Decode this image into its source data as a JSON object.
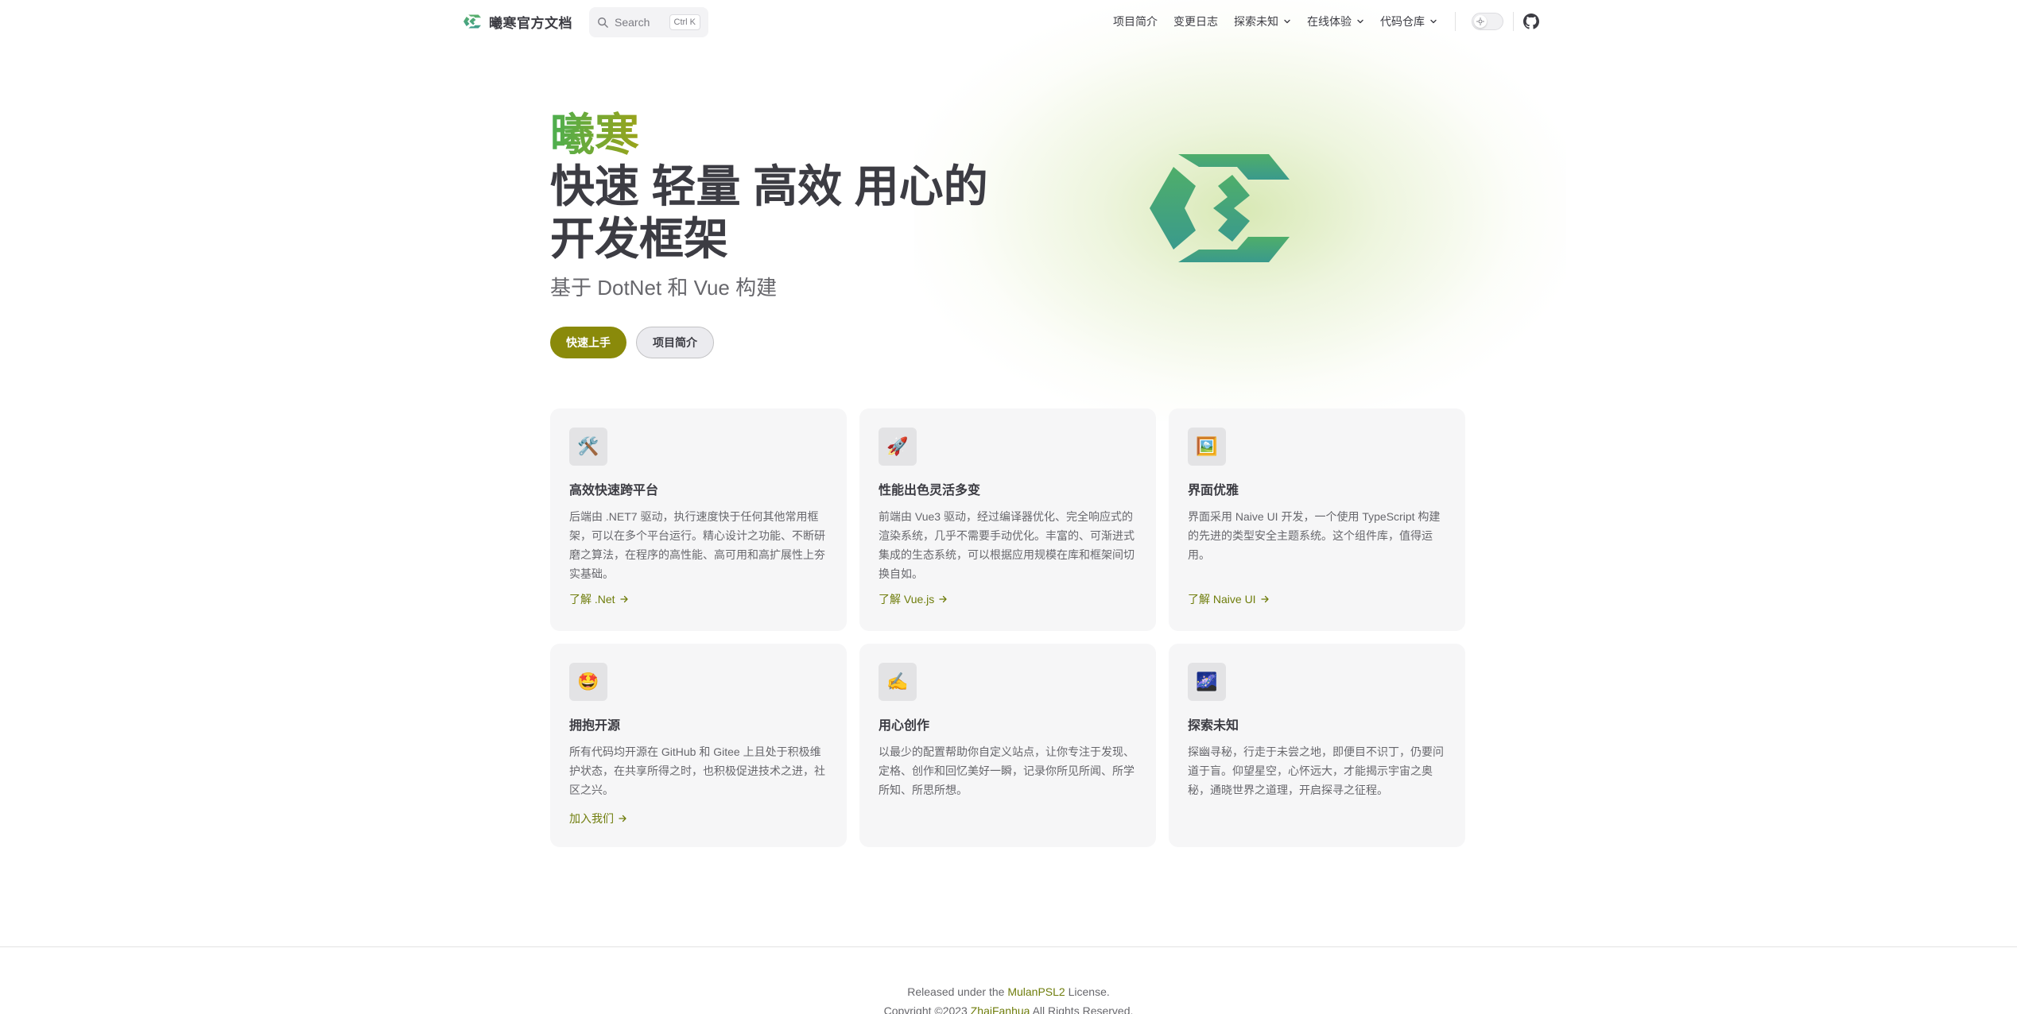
{
  "nav": {
    "title": "曦寒官方文档",
    "search": {
      "label": "Search",
      "shortcut": "Ctrl K"
    },
    "menu": [
      {
        "label": "项目简介",
        "dropdown": false
      },
      {
        "label": "变更日志",
        "dropdown": false
      },
      {
        "label": "探索未知",
        "dropdown": true
      },
      {
        "label": "在线体验",
        "dropdown": true
      },
      {
        "label": "代码仓库",
        "dropdown": true
      }
    ],
    "icons": {
      "logo": "xihan-logo-icon",
      "search": "search-icon",
      "theme": "sun-icon",
      "social": "github-icon"
    }
  },
  "hero": {
    "name": "曦寒",
    "text": "快速 轻量 高效 用心的开发框架",
    "tagline": "基于 DotNet 和 Vue 构建",
    "actions": [
      {
        "label": "快速上手",
        "theme": "brand"
      },
      {
        "label": "项目简介",
        "theme": "alt"
      }
    ]
  },
  "features": [
    {
      "icon": "🛠️",
      "title": "高效快速跨平台",
      "details": "后端由 .NET7 驱动，执行速度快于任何其他常用框架，可以在多个平台运行。精心设计之功能、不断研磨之算法，在程序的高性能、高可用和高扩展性上夯实基础。",
      "link": "了解 .Net"
    },
    {
      "icon": "🚀",
      "title": "性能出色灵活多变",
      "details": "前端由 Vue3 驱动，经过编译器优化、完全响应式的渲染系统，几乎不需要手动优化。丰富的、可渐进式集成的生态系统，可以根据应用规模在库和框架间切换自如。",
      "link": "了解 Vue.js"
    },
    {
      "icon": "🖼️",
      "title": "界面优雅",
      "details": "界面采用 Naive UI 开发，一个使用 TypeScript 构建的先进的类型安全主题系统。这个组件库，值得运用。",
      "link": "了解 Naive UI"
    },
    {
      "icon": "🤩",
      "title": "拥抱开源",
      "details": "所有代码均开源在 GitHub 和 Gitee 上且处于积极维护状态，在共享所得之时，也积极促进技术之进，社区之兴。",
      "link": "加入我们"
    },
    {
      "icon": "✍️",
      "title": "用心创作",
      "details": "以最少的配置帮助你自定义站点，让你专注于发现、定格、创作和回忆美好一瞬，记录你所见所闻、所学所知、所思所想。",
      "link": ""
    },
    {
      "icon": "🌌",
      "title": "探索未知",
      "details": "探幽寻秘，行走于未尝之地，即便目不识丁，仍要问道于盲。仰望星空，心怀远大，才能揭示宇宙之奥秘，通晓世界之道理，开启探寻之征程。",
      "link": ""
    }
  ],
  "footer": {
    "message_prefix": "Released under the ",
    "license": "MulanPSL2",
    "message_suffix": " License.",
    "copyright_prefix": "Copyright ©2023 ",
    "author": "ZhaiFanhua",
    "copyright_suffix": " All Rights Reserved."
  },
  "colors": {
    "brand": "#8a8a0a",
    "link": "#6f7d0c",
    "logo_top": "#4caf50",
    "logo_bottom": "#3a9e8c"
  }
}
